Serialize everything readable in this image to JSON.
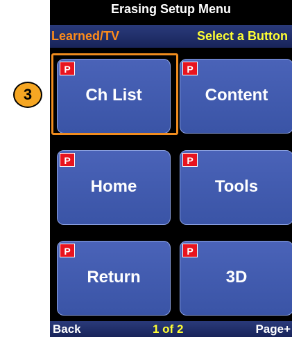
{
  "title": "Erasing Setup Menu",
  "status": {
    "left": "Learned/TV",
    "right": "Select a Button"
  },
  "step_number": "3",
  "buttons": [
    {
      "label": "Ch List",
      "badge": "P"
    },
    {
      "label": "Content",
      "badge": "P"
    },
    {
      "label": "Home",
      "badge": "P"
    },
    {
      "label": "Tools",
      "badge": "P"
    },
    {
      "label": "Return",
      "badge": "P"
    },
    {
      "label": "3D",
      "badge": "P"
    }
  ],
  "footer": {
    "back": "Back",
    "page": "1 of 2",
    "next": "Page+"
  },
  "colors": {
    "accent": "#f08c1e",
    "status_left": "#ff8c1a",
    "status_right": "#ffff33",
    "badge": "#e8141e",
    "button": "#3a54a6"
  }
}
